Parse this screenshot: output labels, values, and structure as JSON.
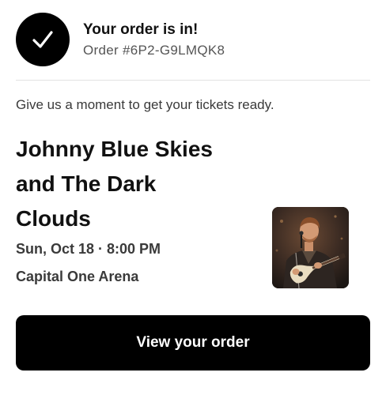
{
  "header": {
    "icon": "checkmark-icon",
    "title": "Your order is in!",
    "order_number": "Order #6P2-G9LMQK8"
  },
  "message": "Give us a moment to get your tickets ready.",
  "event": {
    "title_lines": [
      "Johnny Blue Skies",
      "and The Dark",
      "Clouds"
    ],
    "datetime": "Sun, Oct 18 · 8:00 PM",
    "venue": "Capital One Arena",
    "photo": "performer-photo"
  },
  "actions": {
    "view_order_label": "View your order"
  },
  "colors": {
    "button_bg": "#000000",
    "button_text": "#ffffff",
    "divider": "#e3e3e3"
  }
}
